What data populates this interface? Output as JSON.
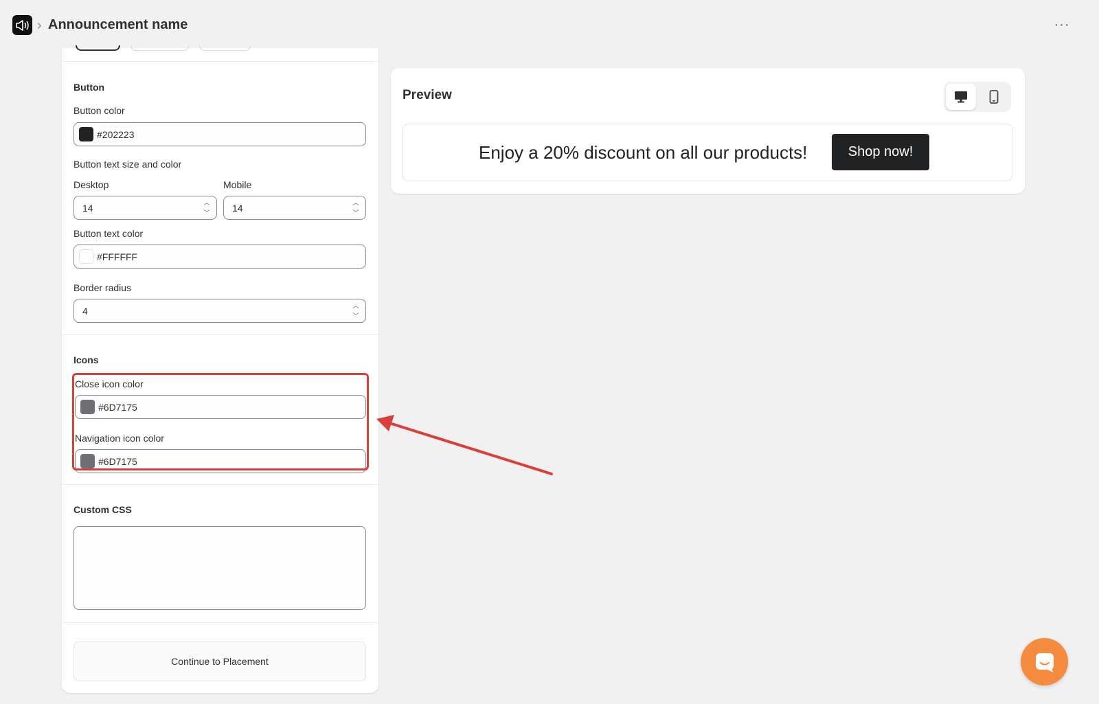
{
  "header": {
    "breadcrumb_separator": "›",
    "title": "Announcement name",
    "more_label": "···"
  },
  "button_section": {
    "title": "Button",
    "button_color_label": "Button color",
    "button_color_value": "#202223",
    "text_size_color_label": "Button text size and color",
    "desktop_label": "Desktop",
    "desktop_value": "14",
    "mobile_label": "Mobile",
    "mobile_value": "14",
    "text_color_label": "Button text color",
    "text_color_value": "#FFFFFF",
    "border_radius_label": "Border radius",
    "border_radius_value": "4"
  },
  "icons_section": {
    "title": "Icons",
    "close_icon_label": "Close icon color",
    "close_icon_value": "#6D7175",
    "navigation_icon_label": "Navigation icon color",
    "navigation_icon_value": "#6D7175"
  },
  "custom_css": {
    "title": "Custom CSS",
    "value": ""
  },
  "footer": {
    "continue_label": "Continue to Placement"
  },
  "preview": {
    "title": "Preview",
    "announcement_text": "Enjoy a 20% discount on all our products!",
    "cta_label": "Shop now!"
  },
  "colors": {
    "button_swatch": "#202223",
    "text_swatch": "#FFFFFF",
    "icon_swatch": "#6D7175",
    "highlight": "#d9403a",
    "chat": "#f48b3f"
  }
}
